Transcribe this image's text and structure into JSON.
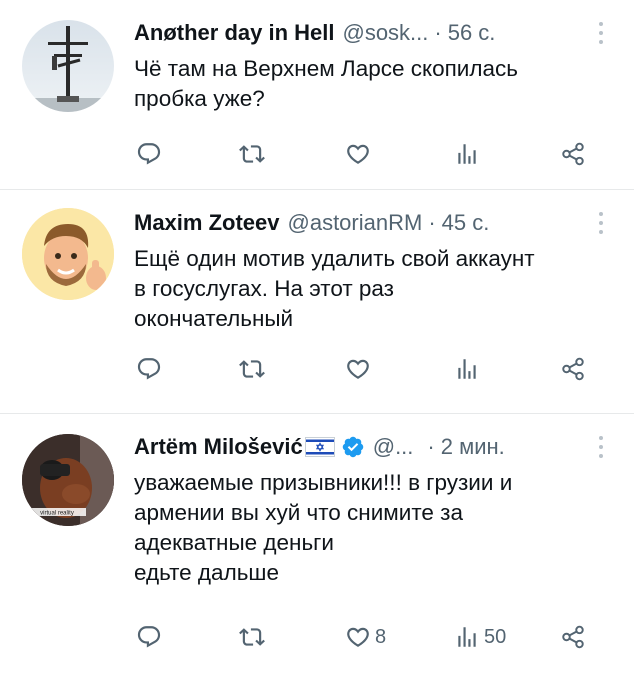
{
  "tweets": [
    {
      "author": "Anøther day in Hell",
      "handle": "@sosk...",
      "separator": "·",
      "time": "56 с.",
      "text": "Чё там на Верхнем Ларсе скопилась\nпробка уже?",
      "counts": {
        "reply": "",
        "retweet": "",
        "like": "",
        "views": ""
      }
    },
    {
      "author": "Maxim Zoteev",
      "handle": "@astorianRM",
      "separator": "·",
      "time": "45 с.",
      "text": "Ещё один мотив удалить свой аккаунт\nв госуслугах. На этот раз\nокончательный",
      "counts": {
        "reply": "",
        "retweet": "",
        "like": "",
        "views": ""
      }
    },
    {
      "author": "Artëm Milošević",
      "handle": "@...",
      "separator": "·",
      "time": "2 мин.",
      "text": "уважаемые призывники!!! в грузии и\nармении вы хуй что снимите за\nадекватные деньги\nедьте дальше",
      "avatar_caption": "virtual reality",
      "counts": {
        "reply": "",
        "retweet": "",
        "like": "8",
        "views": "50"
      }
    }
  ],
  "icons": {
    "reply": "reply-icon",
    "retweet": "retweet-icon",
    "like": "like-icon",
    "views": "views-icon",
    "share": "share-icon",
    "more": "more-options-icon",
    "verified": "verified-badge-icon",
    "flag": "israel-flag-icon"
  },
  "colors": {
    "text": "#0f1419",
    "secondary": "#536471",
    "divider": "#e7e9ea",
    "verified": "#1d9bf0"
  }
}
